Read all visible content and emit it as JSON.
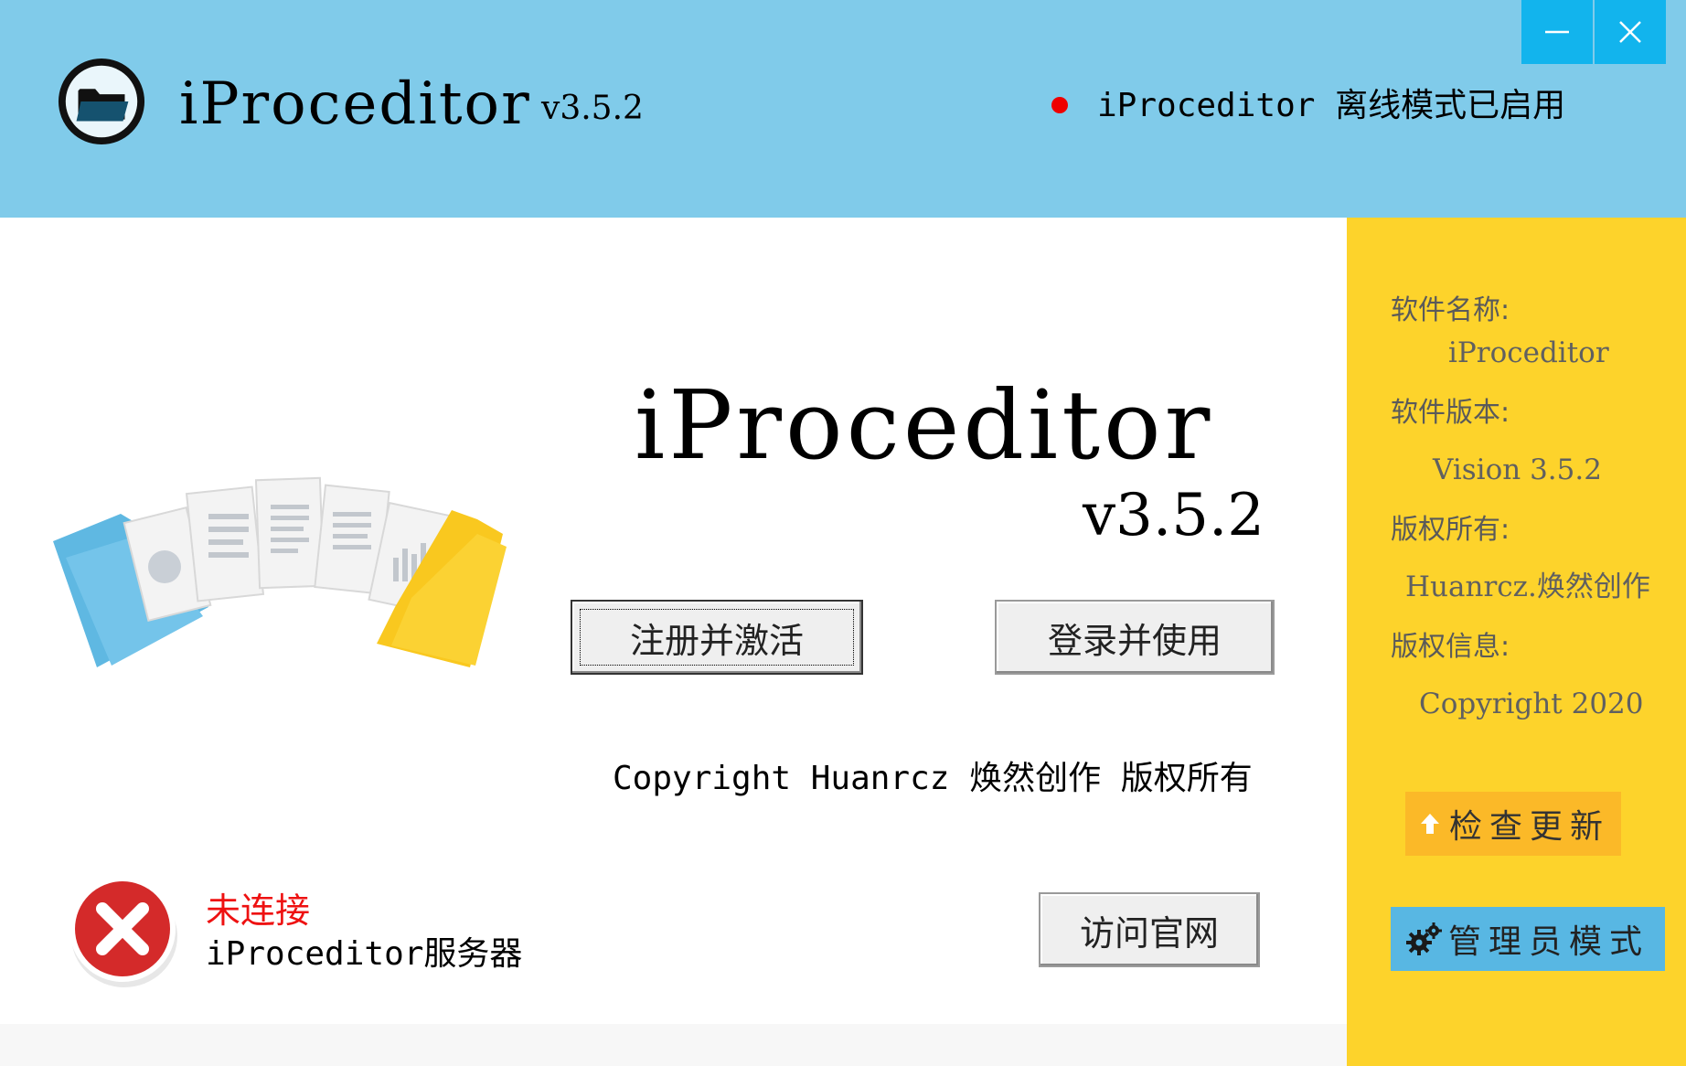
{
  "header": {
    "app_name": "iProceditor",
    "version": "v3.5.2",
    "status_text": "iProceditor 离线模式已启用",
    "minimize_icon": "minimize-icon",
    "close_icon": "close-icon"
  },
  "main": {
    "title": "iProceditor",
    "version": "v3.5.2",
    "register_button": "注册并激活",
    "login_button": "登录并使用",
    "copyright": "Copyright Huanrcz 焕然创作 版权所有",
    "website_button": "访问官网",
    "connection": {
      "status": "未连接",
      "server": "iProceditor服务器"
    }
  },
  "sidebar": {
    "name_label": "软件名称:",
    "name_value": "iProceditor",
    "version_label": "软件版本:",
    "version_value": "Vision 3.5.2",
    "owner_label": "版权所有:",
    "owner_value": "Huanrcz.焕然创作",
    "info_label": "版权信息:",
    "info_value": "Copyright 2020",
    "update_button": "检查更新",
    "admin_button": "管理员模式"
  },
  "colors": {
    "header_bg": "#80cbea",
    "sidebar_bg": "#fdd32b",
    "window_button_bg": "#12b4ed",
    "update_button_bg": "#fbb928",
    "admin_button_bg": "#58b7e3",
    "status_dot": "#ee0000",
    "error_text": "#ee1111"
  }
}
